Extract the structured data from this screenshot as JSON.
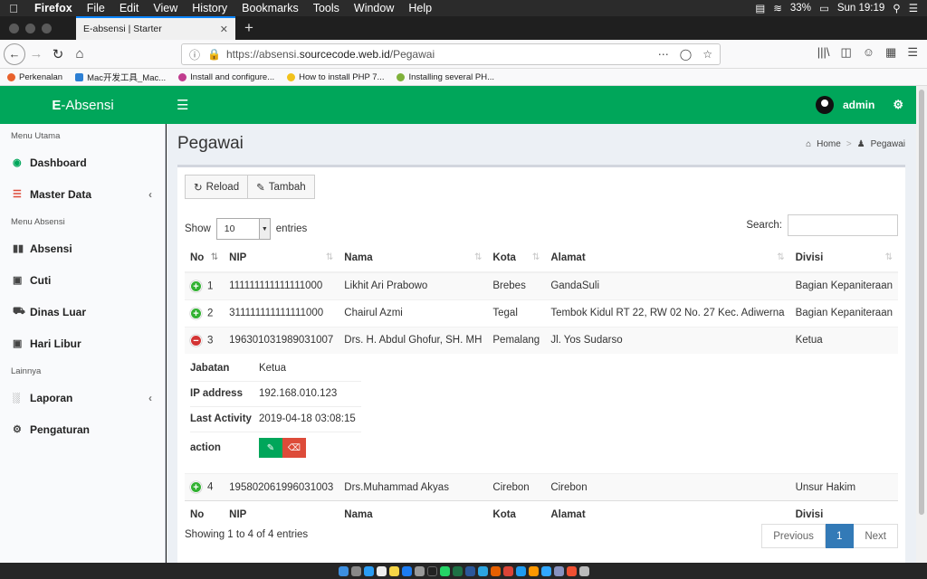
{
  "menubar": {
    "app": "Firefox",
    "items": [
      "File",
      "Edit",
      "View",
      "History",
      "Bookmarks",
      "Tools",
      "Window",
      "Help"
    ],
    "battery": "33%",
    "clock": "Sun 19:19"
  },
  "browser": {
    "tab_title": "E-absensi | Starter",
    "url_prefix": "https://absensi.",
    "url_host": "sourcecode.web.id",
    "url_path": "/Pegawai"
  },
  "bookmarks": [
    {
      "label": "Perkenalan",
      "color": "#e8612c"
    },
    {
      "label": "Mac开发工具_Mac...",
      "color": "#2d7fd3"
    },
    {
      "label": "Install and configure...",
      "color": "#c03c8e"
    },
    {
      "label": "How to install PHP 7...",
      "color": "#f2c21b"
    },
    {
      "label": "Installing several PH...",
      "color": "#7fb13a"
    }
  ],
  "header": {
    "logo_bold": "E",
    "logo_rest": "-Absensi",
    "user": "admin"
  },
  "sidebar": {
    "section1": "Menu Utama",
    "dashboard": "Dashboard",
    "master": "Master Data",
    "section2": "Menu Absensi",
    "absensi": "Absensi",
    "cuti": "Cuti",
    "dinas": "Dinas Luar",
    "libur": "Hari Libur",
    "section3": "Lainnya",
    "laporan": "Laporan",
    "pengaturan": "Pengaturan"
  },
  "page": {
    "title": "Pegawai",
    "crumb_home": "Home",
    "crumb_current": "Pegawai"
  },
  "toolbar": {
    "reload": "Reload",
    "add": "Tambah"
  },
  "table": {
    "show_label": "Show",
    "entries_label": "entries",
    "page_size": "10",
    "search_label": "Search:",
    "columns": [
      "No",
      "NIP",
      "Nama",
      "Kota",
      "Alamat",
      "Divisi"
    ],
    "rows": [
      {
        "no": "1",
        "nip": "111111111111111000",
        "nama": "Likhit Ari Prabowo",
        "kota": "Brebes",
        "alamat": "GandaSuli",
        "divisi": "Bagian Kepaniteraan"
      },
      {
        "no": "2",
        "nip": "311111111111111000",
        "nama": "Chairul Azmi",
        "kota": "Tegal",
        "alamat": "Tembok Kidul RT 22, RW 02 No. 27 Kec. Adiwerna",
        "divisi": "Bagian Kepaniteraan"
      },
      {
        "no": "3",
        "nip": "196301031989031007",
        "nama": "Drs. H. Abdul Ghofur, SH. MH",
        "kota": "Pemalang",
        "alamat": "Jl. Yos Sudarso",
        "divisi": "Ketua"
      },
      {
        "no": "4",
        "nip": "195802061996031003",
        "nama": "Drs.Muhammad Akyas",
        "kota": "Cirebon",
        "alamat": "Cirebon",
        "divisi": "Unsur Hakim"
      }
    ],
    "detail": {
      "jabatan_label": "Jabatan",
      "jabatan": "Ketua",
      "ip_label": "IP address",
      "ip": "192.168.010.123",
      "last_label": "Last Activity",
      "last": "2019-04-18 03:08:15",
      "action_label": "action"
    },
    "info": "Showing 1 to 4 of 4 entries",
    "prev": "Previous",
    "page": "1",
    "next": "Next"
  },
  "colors": {
    "brand": "#00a65a",
    "primary": "#337ab7",
    "danger": "#dd4b39"
  }
}
